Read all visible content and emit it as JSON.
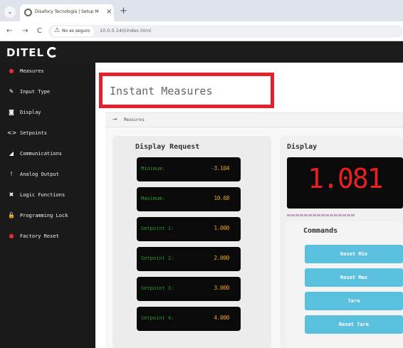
{
  "browser": {
    "tab_title": "Disafocy Tecnología | Setup M",
    "tab_close": "×",
    "new_tab": "+",
    "menu": "⌄",
    "back": "←",
    "forward": "→",
    "reload": "C",
    "security_warning": "No es seguro",
    "url": "10.0.0.140/index.html"
  },
  "app": {
    "logo_text": "DITEL"
  },
  "sidebar": {
    "items": [
      {
        "label": "Measures",
        "icon": "dashboard-icon",
        "glyph": "●"
      },
      {
        "label": "Input Type",
        "icon": "wrench-icon",
        "glyph": "✎"
      },
      {
        "label": "Display",
        "icon": "camera-icon",
        "glyph": "◙"
      },
      {
        "label": "Setpoints",
        "icon": "code-icon",
        "glyph": "<>"
      },
      {
        "label": "Communications",
        "icon": "signal-icon",
        "glyph": "◢"
      },
      {
        "label": "Analog Output",
        "icon": "exclamation-icon",
        "glyph": "!"
      },
      {
        "label": "Logic Functions",
        "icon": "cross-tools-icon",
        "glyph": "✖"
      },
      {
        "label": "Programming Lock",
        "icon": "unlock-icon",
        "glyph": "🔓"
      },
      {
        "label": "Factory Reset",
        "icon": "record-icon",
        "glyph": "●"
      }
    ]
  },
  "main": {
    "page_title": "Instant Measures",
    "panel_label": "Measures",
    "panel_icon": "→",
    "display_request": {
      "title": "Display Request",
      "rows": [
        {
          "label": "Minimum:",
          "value": "-3.104"
        },
        {
          "label": "Maximum:",
          "value": "10.68"
        },
        {
          "label": "Setpoint 1:",
          "value": "1.000"
        },
        {
          "label": "Setpoint 2:",
          "value": "2.000"
        },
        {
          "label": "Setpoint 3:",
          "value": "3.000"
        },
        {
          "label": "Setpoint 4:",
          "value": "4.000"
        }
      ]
    },
    "display": {
      "title": "Display",
      "value": "1.081",
      "led_color": "#e8201e"
    },
    "commands": {
      "title": "Commands",
      "buttons": [
        "Reset Min",
        "Reset Max",
        "Tare",
        "Reset Tare"
      ]
    }
  }
}
